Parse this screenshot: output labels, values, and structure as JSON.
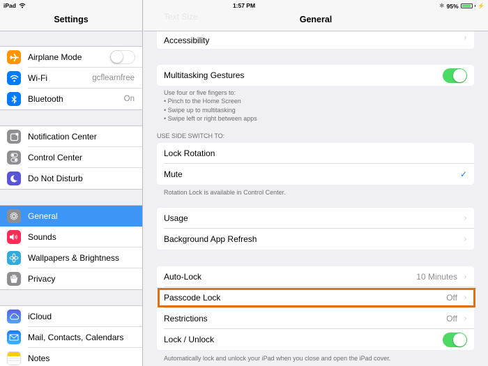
{
  "status_bar": {
    "device": "iPad",
    "time": "1:57 PM",
    "battery": "95%",
    "battery_level": 0.95,
    "icons": [
      "wifi-icon",
      "bluetooth-icon",
      "battery-icon",
      "charging-icon"
    ]
  },
  "left_panel": {
    "title": "Settings",
    "groups": [
      [
        {
          "label": "Airplane Mode",
          "icon": "airplane-icon",
          "icon_color": "#ff9500",
          "toggle": false
        },
        {
          "label": "Wi-Fi",
          "icon": "wifi-icon",
          "icon_color": "#007aff",
          "value": "gcflearnfree"
        },
        {
          "label": "Bluetooth",
          "icon": "bluetooth-icon",
          "icon_color": "#007aff",
          "value": "On"
        }
      ],
      [
        {
          "label": "Notification Center",
          "icon": "notification-center-icon",
          "icon_color": "#8e8e93"
        },
        {
          "label": "Control Center",
          "icon": "control-center-icon",
          "icon_color": "#8e8e93"
        },
        {
          "label": "Do Not Disturb",
          "icon": "moon-icon",
          "icon_color": "#5856d6"
        }
      ],
      [
        {
          "label": "General",
          "icon": "gear-icon",
          "icon_color": "#8e8e93",
          "selected": true
        },
        {
          "label": "Sounds",
          "icon": "speaker-icon",
          "icon_color": "#ff2d55"
        },
        {
          "label": "Wallpapers & Brightness",
          "icon": "flower-icon",
          "icon_color": "#34aadc"
        },
        {
          "label": "Privacy",
          "icon": "hand-icon",
          "icon_color": "#8e8e93"
        }
      ],
      [
        {
          "label": "iCloud",
          "icon": "cloud-icon",
          "icon_color": "#5a7cf0"
        },
        {
          "label": "Mail, Contacts, Calendars",
          "icon": "mail-icon",
          "icon_color": "#1a8cff"
        },
        {
          "label": "Notes",
          "icon": "notes-icon",
          "icon_color": "#ffcc00"
        }
      ]
    ]
  },
  "right_panel": {
    "title": "General",
    "scrolled_under_label": "Text Size",
    "accessibility": {
      "label": "Accessibility"
    },
    "multitasking": {
      "label": "Multitasking Gestures",
      "toggle": true
    },
    "multitasking_footer": [
      "Use four or five fingers to:",
      "• Pinch to the Home Screen",
      "• Swipe up to multitasking",
      "• Swipe left or right between apps"
    ],
    "side_switch_header": "USE SIDE SWITCH TO:",
    "side_switch": [
      {
        "label": "Lock Rotation",
        "checked": false
      },
      {
        "label": "Mute",
        "checked": true
      }
    ],
    "side_switch_footer": "Rotation Lock is available in Control Center.",
    "usage_group": [
      {
        "label": "Usage"
      },
      {
        "label": "Background App Refresh"
      }
    ],
    "lock_group": [
      {
        "label": "Auto-Lock",
        "value": "10 Minutes"
      },
      {
        "label": "Passcode Lock",
        "value": "Off",
        "highlighted": true
      },
      {
        "label": "Restrictions",
        "value": "Off"
      },
      {
        "label": "Lock / Unlock",
        "toggle": true
      }
    ],
    "lock_footer": "Automatically lock and unlock your iPad when you close and open the iPad cover.",
    "highlight_color": "#e07014"
  },
  "colors": {
    "accent": "#3d95f5",
    "toggle_on": "#4cd964",
    "checkmark": "#1e7cf2"
  },
  "glyphs": {
    "chevron": "›",
    "check": "✓"
  }
}
